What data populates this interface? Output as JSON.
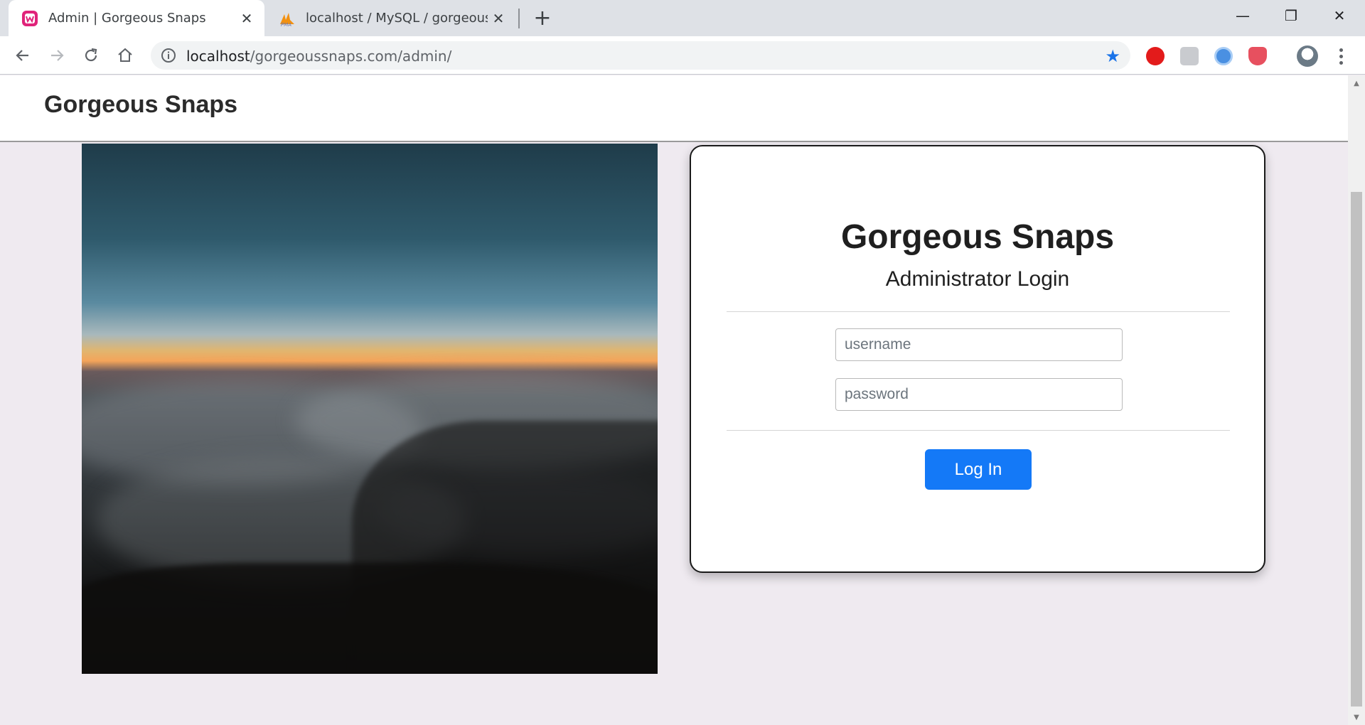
{
  "browser": {
    "tabs": [
      {
        "title": "Admin | Gorgeous Snaps",
        "favicon": "wamp-icon",
        "active": true
      },
      {
        "title": "localhost / MySQL / gorgeoussn",
        "favicon": "phpmyadmin-icon",
        "active": false
      }
    ],
    "new_tab_label": "+",
    "url_host": "localhost",
    "url_path": "/gorgeoussnaps.com/admin/",
    "window_controls": {
      "minimize": "—",
      "restore": "❐",
      "close": "✕"
    },
    "extensions": [
      "adblock-icon",
      "cube-icon",
      "globe-icon",
      "shield-icon",
      "profile-avatar"
    ],
    "accent_color": "#1a73e8"
  },
  "site": {
    "brand": "Gorgeous Snaps"
  },
  "login": {
    "title": "Gorgeous Snaps",
    "subtitle": "Administrator Login",
    "username_placeholder": "username",
    "password_placeholder": "password",
    "submit_label": "Log In",
    "button_color": "#1479f7"
  },
  "hero_image": {
    "subject": "sunrise over sea of clouds from mountain"
  }
}
